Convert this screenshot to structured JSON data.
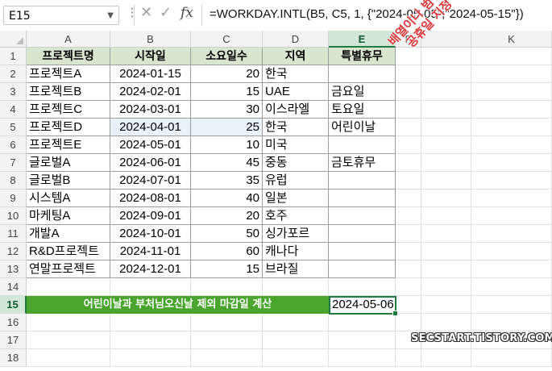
{
  "formula_bar": {
    "name_box": "E15",
    "formula": "=WORKDAY.INTL(B5, C5, 1, {\"2024-05-05\";\"2024-05-15\"})"
  },
  "columns": [
    "A",
    "B",
    "C",
    "D",
    "E",
    "F",
    "K"
  ],
  "rows": [
    "1",
    "2",
    "3",
    "4",
    "5",
    "6",
    "7",
    "8",
    "9",
    "10",
    "11",
    "12",
    "13",
    "14",
    "15",
    "16",
    "17",
    "18"
  ],
  "table": {
    "headers": [
      "프로젝트명",
      "시작일",
      "소요일수",
      "지역",
      "특별휴무"
    ],
    "data": [
      [
        "프로젝트A",
        "2024-01-15",
        "20",
        "한국",
        ""
      ],
      [
        "프로젝트B",
        "2024-02-01",
        "15",
        "UAE",
        "금요일"
      ],
      [
        "프로젝트C",
        "2024-03-01",
        "30",
        "이스라엘",
        "토요일"
      ],
      [
        "프로젝트D",
        "2024-04-01",
        "25",
        "한국",
        "어린이날"
      ],
      [
        "프로젝트E",
        "2024-05-01",
        "10",
        "미국",
        ""
      ],
      [
        "글로벌A",
        "2024-06-01",
        "45",
        "중동",
        "금토휴무"
      ],
      [
        "글로벌B",
        "2024-07-01",
        "35",
        "유럽",
        ""
      ],
      [
        "시스템A",
        "2024-08-01",
        "40",
        "일본",
        ""
      ],
      [
        "마케팅A",
        "2024-09-01",
        "20",
        "호주",
        ""
      ],
      [
        "개발A",
        "2024-10-01",
        "50",
        "싱가포르",
        ""
      ],
      [
        "R&D프로젝트",
        "2024-11-01",
        "60",
        "캐나다",
        ""
      ],
      [
        "연말프로젝트",
        "2024-12-01",
        "15",
        "브라질",
        ""
      ]
    ]
  },
  "row15": {
    "banner": "어린이날과 부처님오신날 제외 마감일 계산",
    "result": "2024-05-06"
  },
  "annotation": [
    "배열이나 범위로",
    "공휴일 지정"
  ],
  "watermark": "SECSTART.TISTORY.COM",
  "colors": {
    "header_fill": "#d9e6cf",
    "banner_fill": "#4aa52e",
    "selection": "#1e7a43",
    "annotation": "#d93a3a"
  }
}
